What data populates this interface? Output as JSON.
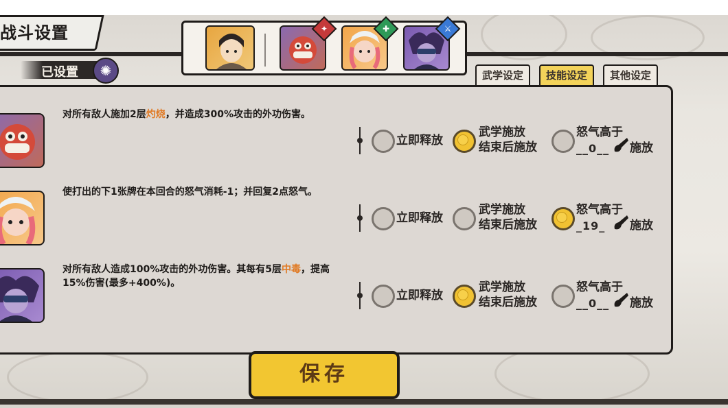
{
  "title": "战斗设置",
  "status_label": "已设置",
  "tabs": [
    {
      "label": "武学设定",
      "active": false
    },
    {
      "label": "技能设定",
      "active": true
    },
    {
      "label": "其他设定",
      "active": false
    }
  ],
  "skills": [
    {
      "desc_parts": [
        "对所有敌人施加2层",
        "灼烧",
        "，并造成300%攻击的外功伤害。"
      ],
      "options": [
        "立即释放",
        "武学施放",
        "结束后施放",
        "怒气高于",
        "施放"
      ],
      "rage_value": "0",
      "selected": 1
    },
    {
      "desc_parts": [
        "使打出的下1张牌在本回合的怒气消耗-1；并回复2点怒气。",
        "",
        ""
      ],
      "options": [
        "立即释放",
        "武学施放",
        "结束后施放",
        "怒气高于",
        "施放"
      ],
      "rage_value": "19",
      "selected": 2
    },
    {
      "desc_parts": [
        "对所有敌人造成100%攻击的外功伤害。其每有5层",
        "中毒",
        "，提高15%伤害(最多+400%)。"
      ],
      "options": [
        "立即释放",
        "武学施放",
        "结束后施放",
        "怒气高于",
        "施放"
      ],
      "rage_value": "0",
      "selected": 1
    }
  ],
  "save_label": "保存",
  "colors": {
    "accent_yellow": "#f2c631",
    "highlight_orange": "#e07a24",
    "dark": "#1e1b19"
  }
}
